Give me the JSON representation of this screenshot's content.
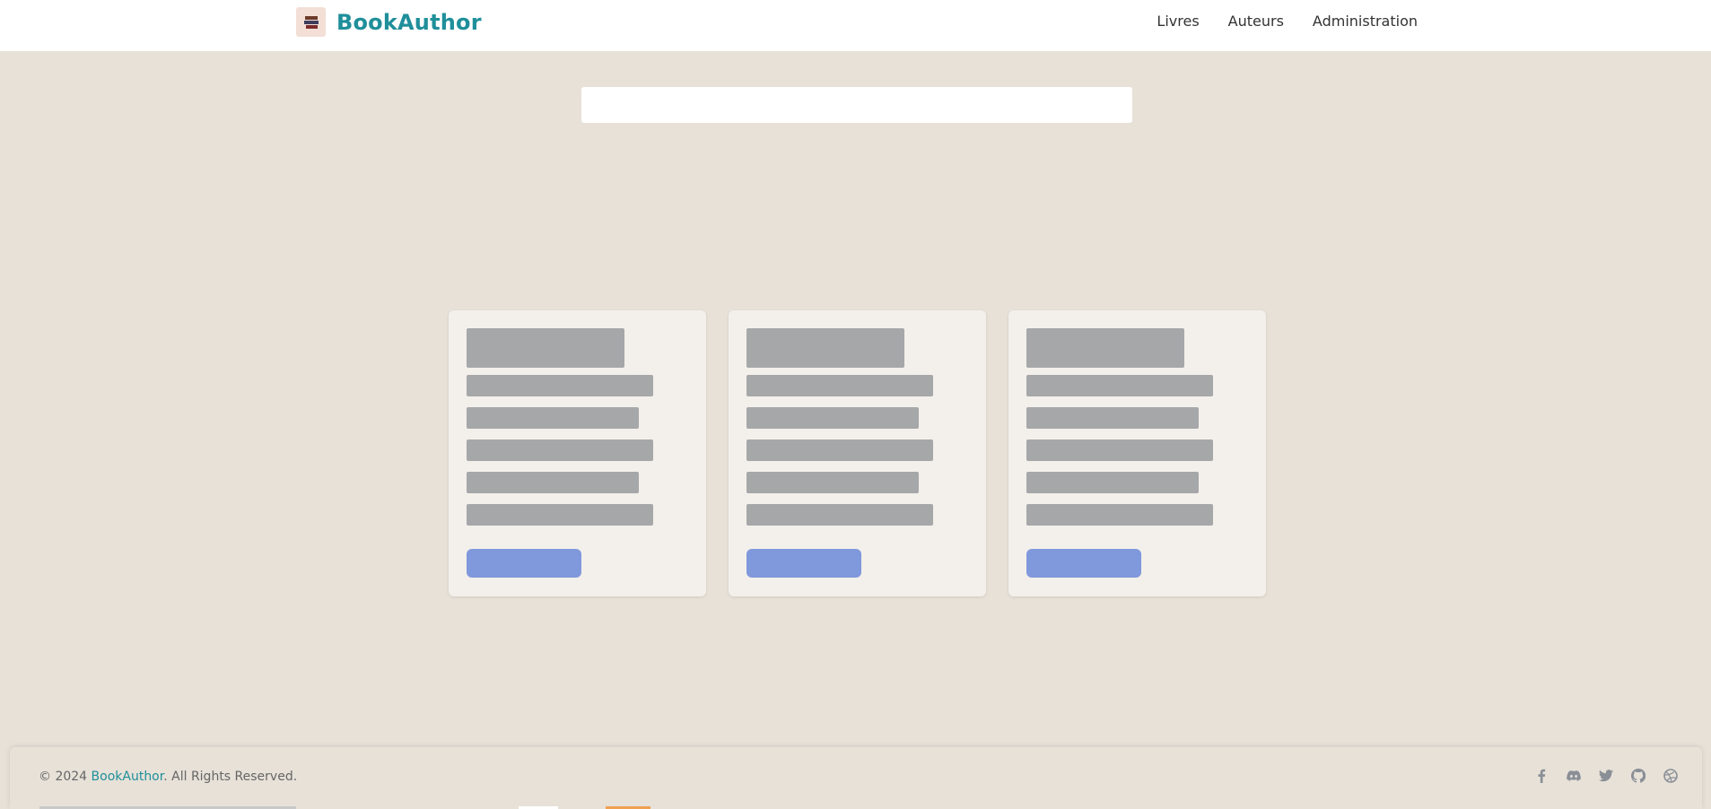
{
  "header": {
    "brand": "BookAuthor",
    "nav": [
      {
        "label": "Livres"
      },
      {
        "label": "Auteurs"
      },
      {
        "label": "Administration"
      }
    ]
  },
  "search": {
    "value": "",
    "placeholder": ""
  },
  "cards_loading": true,
  "footer": {
    "copyright_prefix": "© 2024 ",
    "brand": "BookAuthor",
    "copyright_suffix": ". All Rights Reserved.",
    "socials": [
      "facebook-icon",
      "discord-icon",
      "twitter-icon",
      "github-icon",
      "dribbble-icon"
    ]
  },
  "colors": {
    "brand": "#1f8f9a",
    "background": "#e7e1d8",
    "skeleton": "#a6a7a9",
    "skeleton_button": "#8098dc",
    "card": "#f3f0eb"
  }
}
